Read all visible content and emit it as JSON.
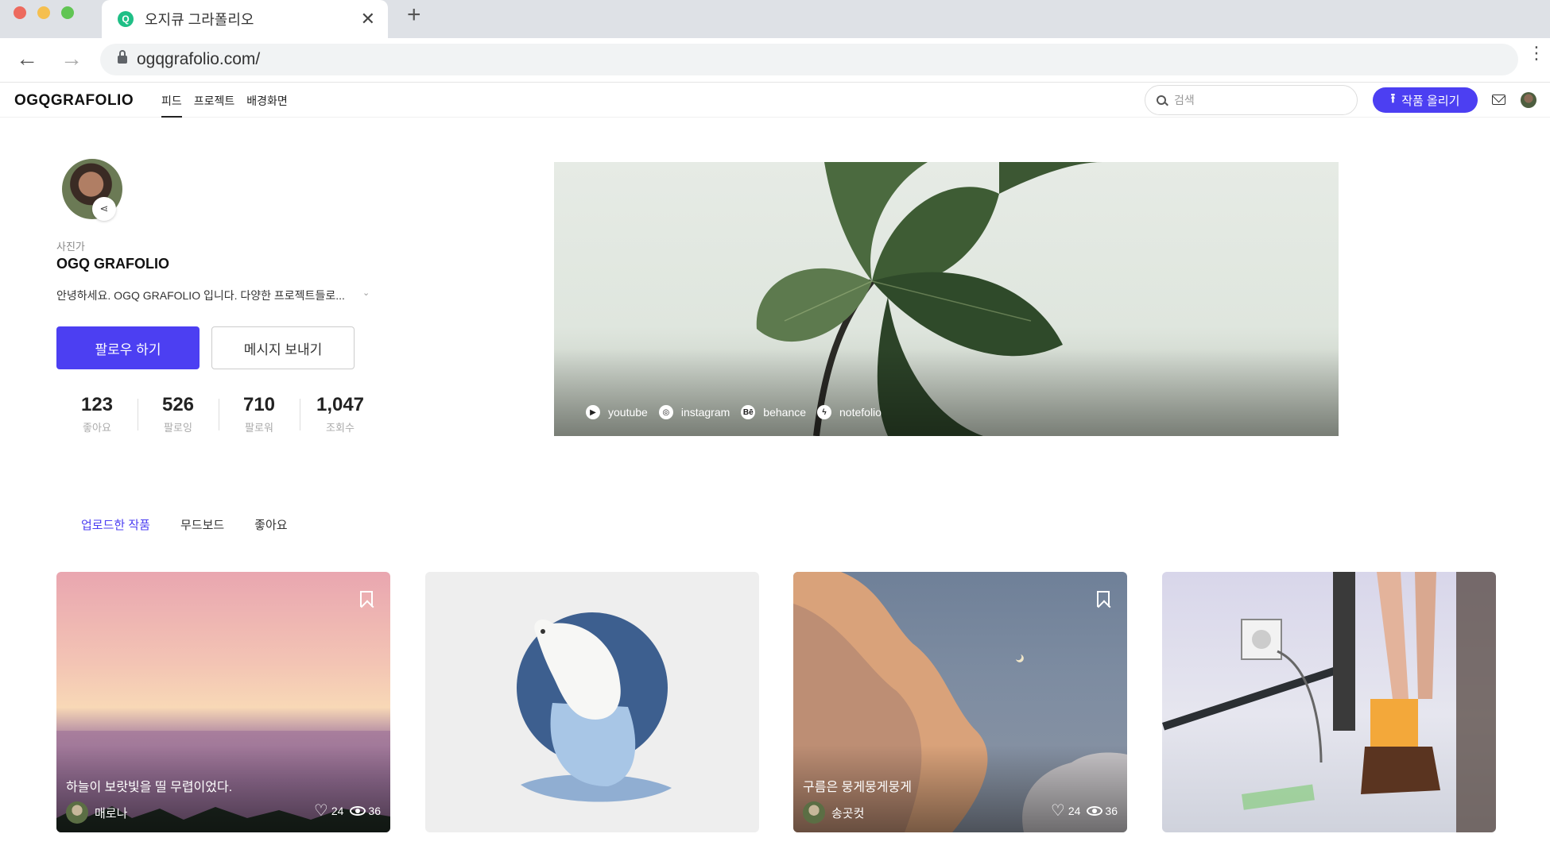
{
  "browser": {
    "tab_title": "오지큐 그라폴리오",
    "url": "ogqgrafolio.com/",
    "new_tab": "+",
    "tab_close": "✕"
  },
  "header": {
    "logo": "OGQGRAFOLIO",
    "nav": [
      "피드",
      "프로젝트",
      "배경화면"
    ],
    "active_nav": "피드",
    "search_placeholder": "검색",
    "upload_label": "작품 올리기"
  },
  "profile": {
    "role": "사진가",
    "name": "OGQ GRAFOLIO",
    "bio": "안녕하세요. OGQ GRAFOLIO 입니다. 다양한 프로젝트들로...",
    "follow_label": "팔로우 하기",
    "message_label": "메시지 보내기",
    "stats": [
      {
        "value": "123",
        "label": "좋아요"
      },
      {
        "value": "526",
        "label": "팔로잉"
      },
      {
        "value": "710",
        "label": "팔로워"
      },
      {
        "value": "1,047",
        "label": "조회수"
      }
    ]
  },
  "cover": {
    "links": [
      {
        "icon": "youtube-icon",
        "label": "youtube",
        "glyph": "▶"
      },
      {
        "icon": "instagram-icon",
        "label": "instagram",
        "glyph": "◎"
      },
      {
        "icon": "behance-icon",
        "label": "behance",
        "glyph": "Bē"
      },
      {
        "icon": "notefolio-icon",
        "label": "notefolio",
        "glyph": "ϟ"
      }
    ]
  },
  "content_tabs": [
    "업로드한 작품",
    "무드보드",
    "좋아요"
  ],
  "active_content_tab": "업로드한 작품",
  "cards": [
    {
      "title": "하늘이 보랏빛을 띨 무렵이었다.",
      "author": "매로나",
      "likes": "24",
      "views": "36"
    },
    {
      "title": "",
      "author": "",
      "likes": "",
      "views": ""
    },
    {
      "title": "구름은 뭉게뭉게뭉게",
      "author": "송곳컷",
      "likes": "24",
      "views": "36"
    },
    {
      "title": "",
      "author": "",
      "likes": "",
      "views": ""
    }
  ],
  "colors": {
    "accent": "#4c3ff2"
  }
}
